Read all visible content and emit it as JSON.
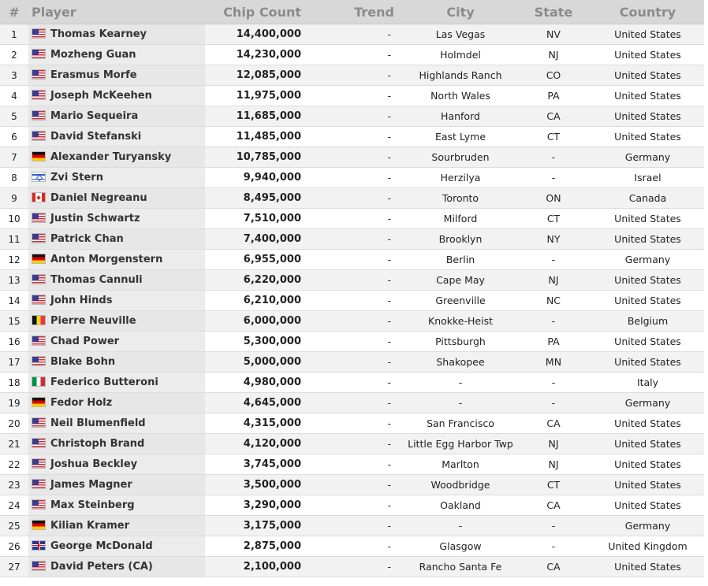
{
  "table": {
    "headers": {
      "rank": "#",
      "player": "Player",
      "chips": "Chip Count",
      "trend": "Trend",
      "city": "City",
      "state": "State",
      "country": "Country"
    },
    "rows": [
      {
        "rank": "1",
        "flag": "us",
        "player": "Thomas Kearney",
        "chips": "14,400,000",
        "trend": "-",
        "city": "Las Vegas",
        "state": "NV",
        "country": "United States"
      },
      {
        "rank": "2",
        "flag": "us",
        "player": "Mozheng Guan",
        "chips": "14,230,000",
        "trend": "-",
        "city": "Holmdel",
        "state": "NJ",
        "country": "United States"
      },
      {
        "rank": "3",
        "flag": "us",
        "player": "Erasmus Morfe",
        "chips": "12,085,000",
        "trend": "-",
        "city": "Highlands Ranch",
        "state": "CO",
        "country": "United States"
      },
      {
        "rank": "4",
        "flag": "us",
        "player": "Joseph McKeehen",
        "chips": "11,975,000",
        "trend": "-",
        "city": "North Wales",
        "state": "PA",
        "country": "United States"
      },
      {
        "rank": "5",
        "flag": "us",
        "player": "Mario Sequeira",
        "chips": "11,685,000",
        "trend": "-",
        "city": "Hanford",
        "state": "CA",
        "country": "United States"
      },
      {
        "rank": "6",
        "flag": "us",
        "player": "David Stefanski",
        "chips": "11,485,000",
        "trend": "-",
        "city": "East Lyme",
        "state": "CT",
        "country": "United States"
      },
      {
        "rank": "7",
        "flag": "de",
        "player": "Alexander Turyansky",
        "chips": "10,785,000",
        "trend": "-",
        "city": "Sourbruden",
        "state": "-",
        "country": "Germany"
      },
      {
        "rank": "8",
        "flag": "il",
        "player": "Zvi Stern",
        "chips": "9,940,000",
        "trend": "-",
        "city": "Herzilya",
        "state": "-",
        "country": "Israel"
      },
      {
        "rank": "9",
        "flag": "ca",
        "player": "Daniel Negreanu",
        "chips": "8,495,000",
        "trend": "-",
        "city": "Toronto",
        "state": "ON",
        "country": "Canada"
      },
      {
        "rank": "10",
        "flag": "us",
        "player": "Justin Schwartz",
        "chips": "7,510,000",
        "trend": "-",
        "city": "Milford",
        "state": "CT",
        "country": "United States"
      },
      {
        "rank": "11",
        "flag": "us",
        "player": "Patrick Chan",
        "chips": "7,400,000",
        "trend": "-",
        "city": "Brooklyn",
        "state": "NY",
        "country": "United States"
      },
      {
        "rank": "12",
        "flag": "de",
        "player": "Anton Morgenstern",
        "chips": "6,955,000",
        "trend": "-",
        "city": "Berlin",
        "state": "-",
        "country": "Germany"
      },
      {
        "rank": "13",
        "flag": "us",
        "player": "Thomas Cannuli",
        "chips": "6,220,000",
        "trend": "-",
        "city": "Cape May",
        "state": "NJ",
        "country": "United States"
      },
      {
        "rank": "14",
        "flag": "us",
        "player": "John Hinds",
        "chips": "6,210,000",
        "trend": "-",
        "city": "Greenville",
        "state": "NC",
        "country": "United States"
      },
      {
        "rank": "15",
        "flag": "be",
        "player": "Pierre Neuville",
        "chips": "6,000,000",
        "trend": "-",
        "city": "Knokke-Heist",
        "state": "-",
        "country": "Belgium"
      },
      {
        "rank": "16",
        "flag": "us",
        "player": "Chad Power",
        "chips": "5,300,000",
        "trend": "-",
        "city": "Pittsburgh",
        "state": "PA",
        "country": "United States"
      },
      {
        "rank": "17",
        "flag": "us",
        "player": "Blake Bohn",
        "chips": "5,000,000",
        "trend": "-",
        "city": "Shakopee",
        "state": "MN",
        "country": "United States"
      },
      {
        "rank": "18",
        "flag": "it",
        "player": "Federico Butteroni",
        "chips": "4,980,000",
        "trend": "-",
        "city": "-",
        "state": "-",
        "country": "Italy"
      },
      {
        "rank": "19",
        "flag": "de",
        "player": "Fedor Holz",
        "chips": "4,645,000",
        "trend": "-",
        "city": "-",
        "state": "-",
        "country": "Germany"
      },
      {
        "rank": "20",
        "flag": "us",
        "player": "Neil Blumenfield",
        "chips": "4,315,000",
        "trend": "-",
        "city": "San Francisco",
        "state": "CA",
        "country": "United States"
      },
      {
        "rank": "21",
        "flag": "us",
        "player": "Christoph Brand",
        "chips": "4,120,000",
        "trend": "-",
        "city": "Little Egg Harbor Twp",
        "state": "NJ",
        "country": "United States"
      },
      {
        "rank": "22",
        "flag": "us",
        "player": "Joshua Beckley",
        "chips": "3,745,000",
        "trend": "-",
        "city": "Marlton",
        "state": "NJ",
        "country": "United States"
      },
      {
        "rank": "23",
        "flag": "us",
        "player": "James Magner",
        "chips": "3,500,000",
        "trend": "-",
        "city": "Woodbridge",
        "state": "CT",
        "country": "United States"
      },
      {
        "rank": "24",
        "flag": "us",
        "player": "Max Steinberg",
        "chips": "3,290,000",
        "trend": "-",
        "city": "Oakland",
        "state": "CA",
        "country": "United States"
      },
      {
        "rank": "25",
        "flag": "de",
        "player": "Kilian Kramer",
        "chips": "3,175,000",
        "trend": "-",
        "city": "-",
        "state": "-",
        "country": "Germany"
      },
      {
        "rank": "26",
        "flag": "gb",
        "player": "George McDonald",
        "chips": "2,875,000",
        "trend": "-",
        "city": "Glasgow",
        "state": "-",
        "country": "United Kingdom"
      },
      {
        "rank": "27",
        "flag": "us",
        "player": "David Peters (CA)",
        "chips": "2,100,000",
        "trend": "-",
        "city": "Rancho Santa Fe",
        "state": "CA",
        "country": "United States"
      }
    ]
  }
}
